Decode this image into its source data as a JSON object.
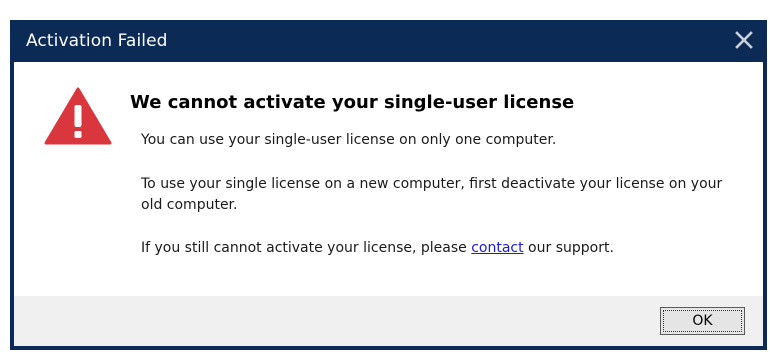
{
  "dialog": {
    "title": "Activation Failed",
    "close_icon": "close-icon",
    "warning_icon": "warning-triangle-icon",
    "heading": "We cannot activate your single-user license",
    "paragraph1": "You can use your single-user license on only one computer.",
    "paragraph2": "To use your single license on a new computer, first deactivate your license on your old computer.",
    "paragraph3_before": "If you still cannot activate your license, please ",
    "paragraph3_link": "contact",
    "paragraph3_after": " our support.",
    "ok_label": "OK"
  },
  "colors": {
    "titlebar": "#0b2a55",
    "warning": "#d9363e",
    "link": "#1a1ae6",
    "footer": "#f0f0f0"
  }
}
